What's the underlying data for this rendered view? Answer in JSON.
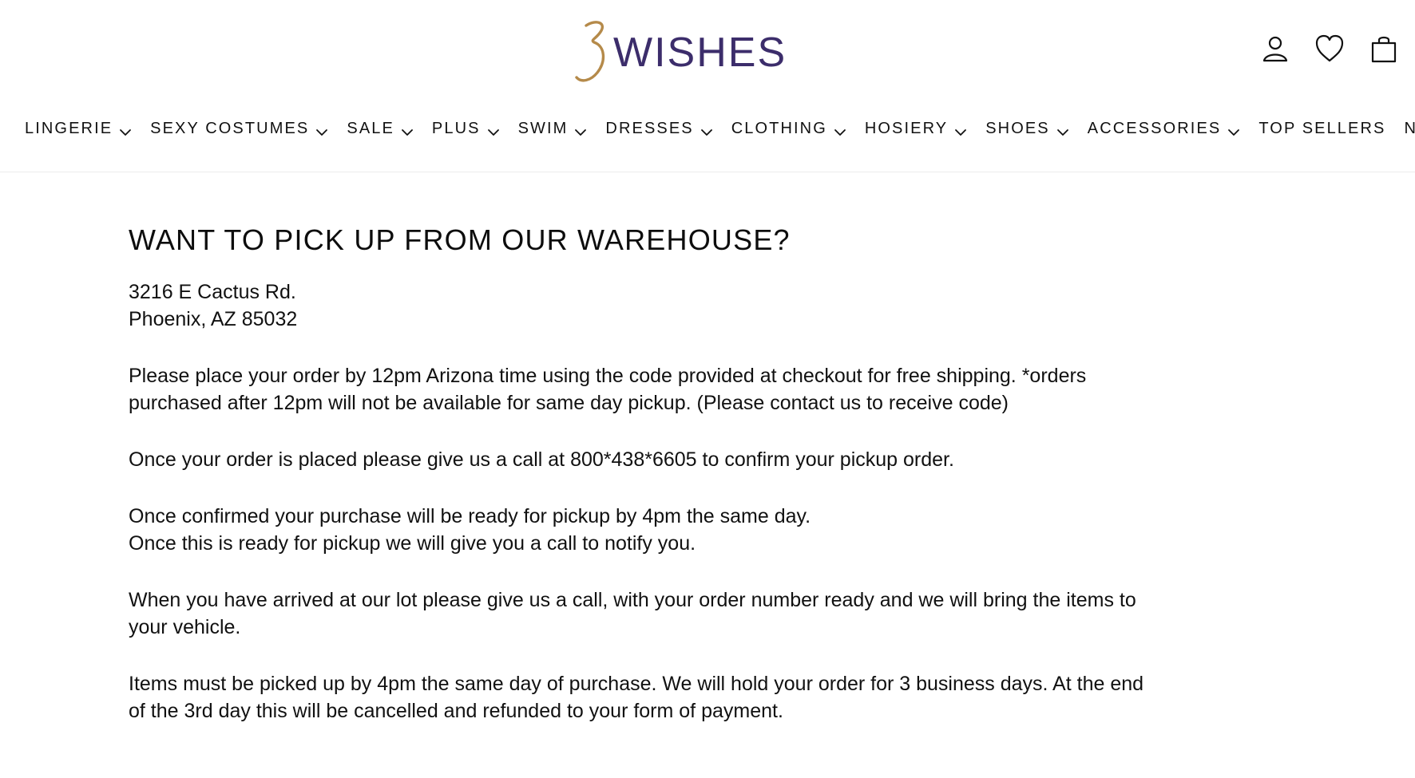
{
  "header": {
    "logo": {
      "mark_text": "3",
      "wordmark": "WISHES",
      "mark_color": "#b58a4a",
      "word_color": "#3c2d6b"
    },
    "icons": [
      {
        "name": "user-icon"
      },
      {
        "name": "heart-icon"
      },
      {
        "name": "shopping-bag-icon"
      }
    ]
  },
  "navigation": {
    "items": [
      {
        "label": "LINGERIE",
        "dropdown": true
      },
      {
        "label": "SEXY COSTUMES",
        "dropdown": true
      },
      {
        "label": "SALE",
        "dropdown": true
      },
      {
        "label": "PLUS",
        "dropdown": true
      },
      {
        "label": "SWIM",
        "dropdown": true
      },
      {
        "label": "DRESSES",
        "dropdown": true
      },
      {
        "label": "CLOTHING",
        "dropdown": true
      },
      {
        "label": "HOSIERY",
        "dropdown": true
      },
      {
        "label": "SHOES",
        "dropdown": true
      },
      {
        "label": "ACCESSORIES",
        "dropdown": true
      },
      {
        "label": "TOP SELLERS",
        "dropdown": false
      },
      {
        "label": "NEW",
        "dropdown": false
      }
    ]
  },
  "page": {
    "title": "WANT TO PICK UP FROM OUR WAREHOUSE?",
    "address": {
      "line1": "3216 E Cactus Rd.",
      "line2": "Phoenix, AZ 85032"
    },
    "paragraphs": {
      "order_by_line1": "Please place your order by 12pm Arizona time using the code provided at checkout for free shipping. *orders",
      "order_by_line2": "purchased after 12pm will not be available for same day pickup. (Please contact us to receive code)",
      "call_confirm": "Once your order is placed please give us a call at 800*438*6605 to confirm your pickup order.",
      "ready_line1": "Once confirmed your purchase will be ready for pickup by 4pm the same day.",
      "ready_line2": "Once this is ready for pickup we will give you a call to notify you.",
      "arrival_line1": "When you have arrived at our lot please give us a call, with your order number ready and we will bring the items to",
      "arrival_line2": "your vehicle.",
      "hold_line1": "Items must be picked up by 4pm the same day of purchase. We will hold your order for 3 business days. At the end",
      "hold_line2": "of the 3rd day this will be cancelled and refunded to your form of payment."
    }
  }
}
